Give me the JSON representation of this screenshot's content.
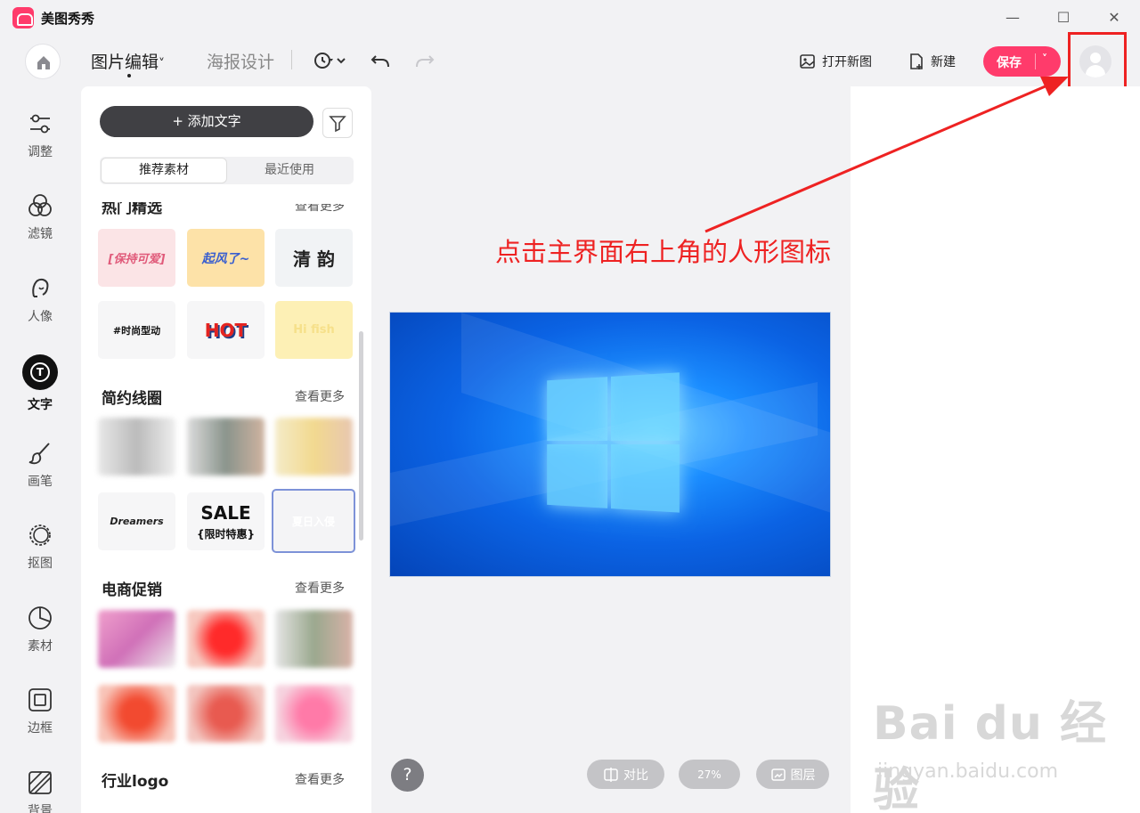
{
  "app": {
    "name": "美图秀秀",
    "window_controls": {
      "minimize": "—",
      "maximize": "☐",
      "close": "✕"
    }
  },
  "toolbar": {
    "modes": [
      {
        "label": "图片编辑",
        "suffix": "˅",
        "active": true
      },
      {
        "label": "海报设计",
        "active": false
      }
    ],
    "open_image_label": "打开新图",
    "new_label": "新建",
    "save_label": "保存",
    "save_caret": "˅"
  },
  "left_rail": {
    "items": [
      {
        "label": "调整",
        "icon": "sliders-icon"
      },
      {
        "label": "滤镜",
        "icon": "filter-circles-icon"
      },
      {
        "label": "人像",
        "icon": "portrait-icon"
      },
      {
        "label": "文字",
        "icon": "text-icon",
        "active": true
      },
      {
        "label": "画笔",
        "icon": "brush-icon"
      },
      {
        "label": "抠图",
        "icon": "cutout-icon"
      },
      {
        "label": "素材",
        "icon": "sticker-icon"
      },
      {
        "label": "边框",
        "icon": "frame-icon"
      },
      {
        "label": "背景",
        "icon": "background-icon"
      }
    ]
  },
  "panel": {
    "add_text_label": "+ 添加文字",
    "segments": [
      "推荐素材",
      "最近使用"
    ],
    "sections": [
      {
        "title": "热门精选",
        "more": "查看更多"
      },
      {
        "title": "简约线圈",
        "more": "查看更多"
      },
      {
        "title": "电商促销",
        "more": "查看更多"
      },
      {
        "title": "行业logo",
        "more": "查看更多"
      }
    ],
    "sample_texts": [
      "[保持可爱]",
      "起风了~",
      "清 韵",
      "#时尚型动",
      "HOT",
      "Hi fish",
      "Dreamers",
      "SALE",
      "{限时特惠}",
      "夏日入侵"
    ]
  },
  "annotation": "点击主界面右上角的人形图标",
  "bottom": {
    "help": "?",
    "compare_label": "对比",
    "zoom_label": "27%",
    "layers_label": "图层"
  },
  "watermark": {
    "main": "Bai du 经验",
    "sub": "jingyan.baidu.com"
  },
  "colors": {
    "accent": "#ff3b6b",
    "annotation": "#ee2222"
  }
}
